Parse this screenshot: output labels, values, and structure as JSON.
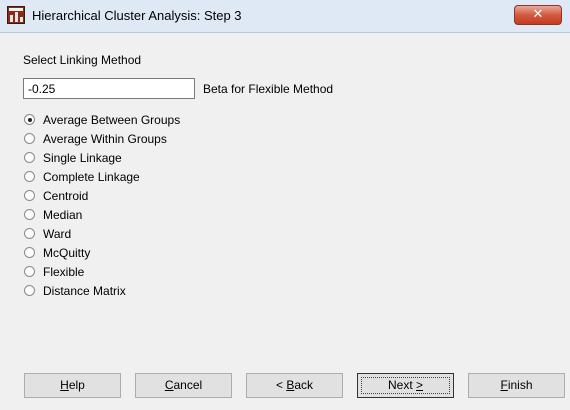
{
  "window": {
    "title": "Hierarchical Cluster Analysis: Step 3",
    "close_glyph": "✕"
  },
  "section": {
    "label": "Select Linking Method"
  },
  "beta": {
    "value": "-0.25",
    "label": "Beta for Flexible Method"
  },
  "methods": [
    {
      "label": "Average Between Groups",
      "checked": true
    },
    {
      "label": "Average Within Groups",
      "checked": false
    },
    {
      "label": "Single Linkage",
      "checked": false
    },
    {
      "label": "Complete Linkage",
      "checked": false
    },
    {
      "label": "Centroid",
      "checked": false
    },
    {
      "label": "Median",
      "checked": false
    },
    {
      "label": "Ward",
      "checked": false
    },
    {
      "label": "McQuitty",
      "checked": false
    },
    {
      "label": "Flexible",
      "checked": false
    },
    {
      "label": "Distance Matrix",
      "checked": false
    }
  ],
  "buttons": {
    "help": {
      "mnemonic": "H",
      "rest": "elp"
    },
    "cancel": {
      "mnemonic": "C",
      "rest": "ancel"
    },
    "back": {
      "pre": "< ",
      "mnemonic": "B",
      "rest": "ack"
    },
    "next": {
      "pre": "Next ",
      "mnemonic": ">",
      "rest": ""
    },
    "finish": {
      "mnemonic": "F",
      "rest": "inish"
    }
  },
  "colors": {
    "title_bar": "#dfe9f5",
    "close_button": "#d35b41",
    "dialog_bg": "#f0f0f0"
  },
  "icons": {
    "app": "bar-chart-icon",
    "close": "close-icon"
  }
}
